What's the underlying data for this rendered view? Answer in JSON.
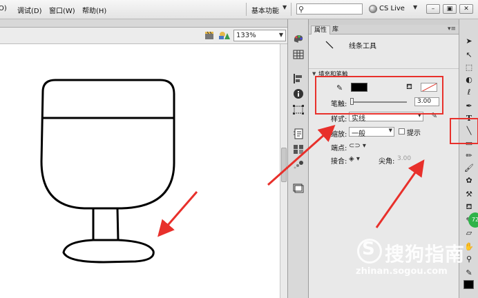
{
  "menu": {
    "items": [
      "O)",
      "调试(D)",
      "窗口(W)",
      "帮助(H)"
    ],
    "workspace": "基本功能",
    "search_placeholder": "",
    "cs_live": "CS Live"
  },
  "stage": {
    "zoom": "133%"
  },
  "properties": {
    "tabs": [
      "属性",
      "库"
    ],
    "tool_name": "线条工具",
    "section_title": "填充和笔触",
    "stroke_label": "笔触:",
    "stroke_value": "3.00",
    "stroke_color": "#000000",
    "style_label": "样式:",
    "style_value": "实线",
    "scale_label": "缩放:",
    "scale_value": "一般",
    "hint_label": "提示",
    "cap_label": "端点:",
    "join_label": "接合:",
    "miter_label": "尖角:",
    "miter_value": "3.00"
  },
  "tools": {
    "badge": "72"
  },
  "annotation_color": "#e8302b",
  "watermark": {
    "logo_letter": "S",
    "text": "搜狗指南",
    "url": "zhinan.sogou.com"
  }
}
